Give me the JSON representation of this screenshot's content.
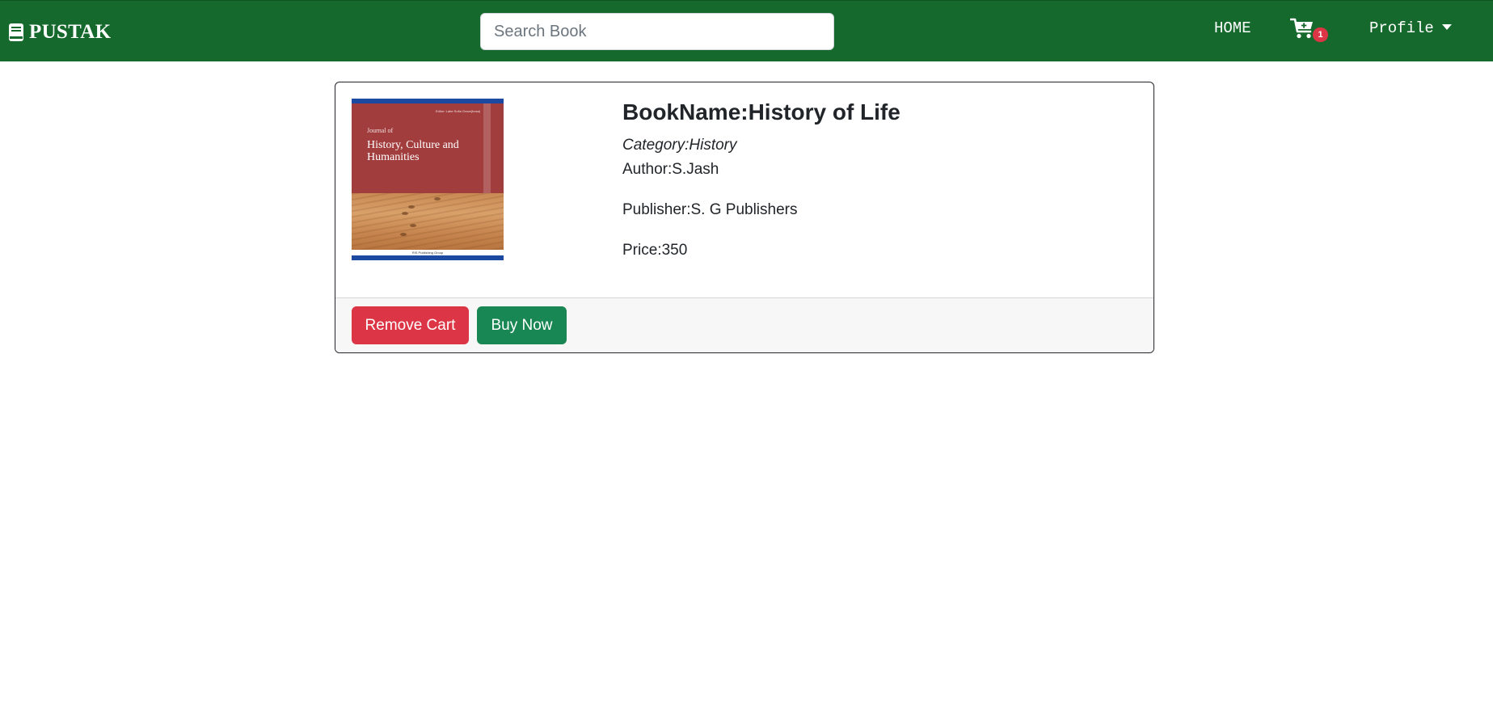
{
  "brand": {
    "name": "PUSTAK",
    "icon": "book-icon"
  },
  "search": {
    "placeholder": "Search Book",
    "value": ""
  },
  "nav": {
    "home_label": "HOME",
    "cart_icon": "cart-plus-icon",
    "cart_count": "1",
    "profile_label": "Profile",
    "profile_caret_icon": "caret-down-icon"
  },
  "book": {
    "title": "BookName:History of Life",
    "category": "Category:History",
    "author": "Author:S.Jash",
    "publisher": "Publisher:S. G Publishers",
    "price": "Price:350",
    "cover": {
      "journal_prefix": "Journal of",
      "journal_title": "History, Culture and Humanities",
      "editor_line": "Editor: Labe Sofia Grace(bosa)",
      "publisher_line": "RIS Publishing Group"
    }
  },
  "actions": {
    "remove_label": "Remove Cart",
    "buy_label": "Buy Now"
  },
  "colors": {
    "navbar": "#15692d",
    "remove": "#dc3545",
    "buy": "#198754",
    "badge": "#dc3545"
  }
}
